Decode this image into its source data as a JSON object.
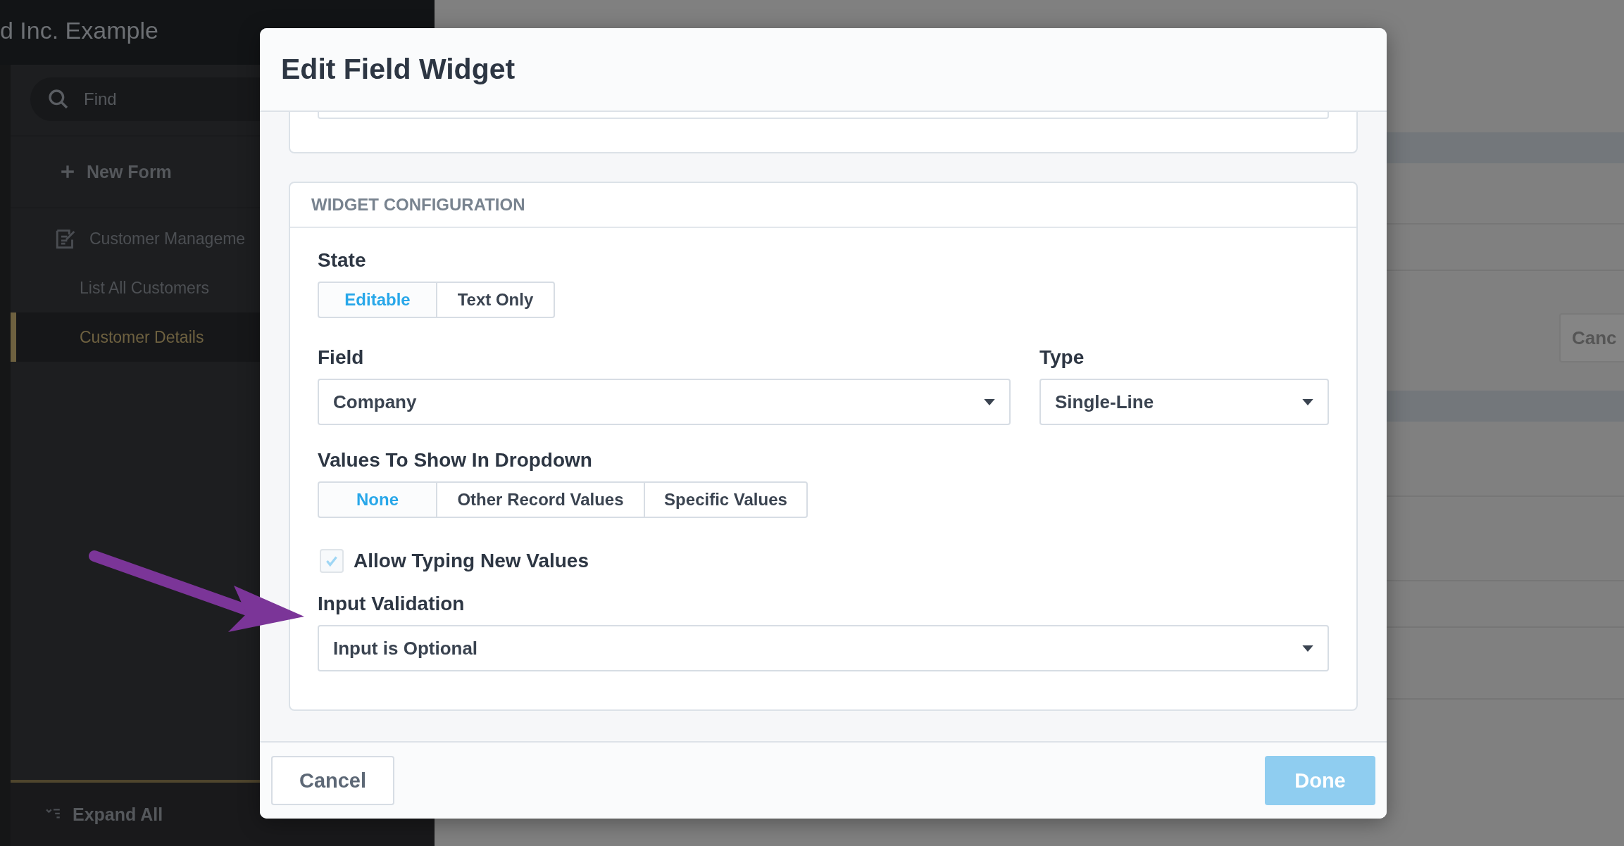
{
  "sidebar": {
    "title": "d Inc. Example",
    "search": {
      "placeholder": "Find"
    },
    "new_button": "New Form",
    "items": [
      {
        "label": "Customer Manageme",
        "kind": "folder",
        "selected": false
      },
      {
        "label": "List All Customers",
        "kind": "page",
        "selected": false
      },
      {
        "label": "Customer Details",
        "kind": "page",
        "selected": true
      }
    ],
    "footer_button": "Expand All"
  },
  "background": {
    "button": "Canc"
  },
  "dialog": {
    "title": "Edit Field Widget",
    "section": {
      "title": "WIDGET CONFIGURATION",
      "state": {
        "label": "State",
        "options": [
          {
            "label": "Editable",
            "selected": true
          },
          {
            "label": "Text Only",
            "selected": false
          }
        ]
      },
      "field": {
        "label": "Field",
        "value": "Company"
      },
      "type": {
        "label": "Type",
        "value": "Single-Line"
      },
      "values_to_show": {
        "label": "Values To Show In Dropdown",
        "options": [
          {
            "label": "None",
            "selected": true
          },
          {
            "label": "Other Record Values",
            "selected": false
          },
          {
            "label": "Specific Values",
            "selected": false
          }
        ]
      },
      "allow_typing": {
        "label": "Allow Typing New Values",
        "checked": true,
        "disabled": true
      },
      "input_validation": {
        "label": "Input Validation",
        "value": "Input is Optional"
      }
    },
    "buttons": [
      {
        "label": "Cancel",
        "kind": "secondary",
        "disabled": false
      },
      {
        "label": "Done",
        "kind": "primary",
        "disabled": true
      }
    ]
  }
}
